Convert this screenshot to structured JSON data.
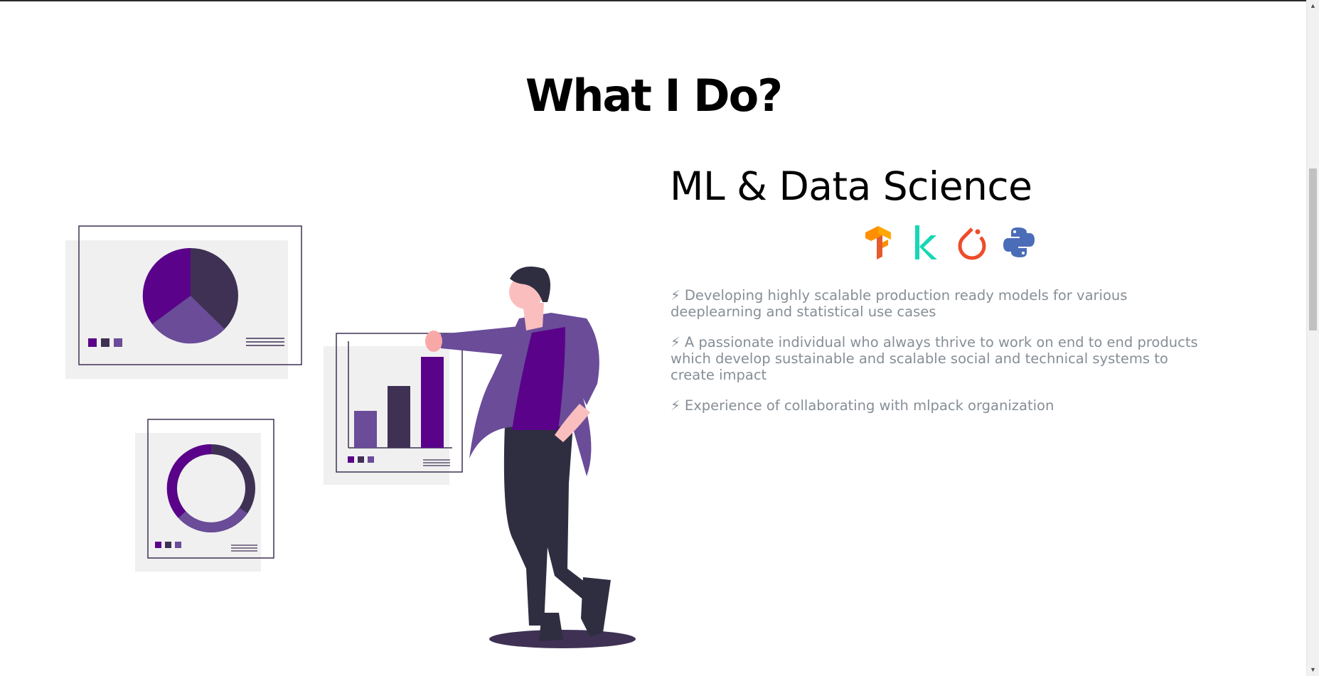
{
  "page": {
    "title": "What I Do?"
  },
  "section": {
    "title": "ML & Data Science",
    "skills": [
      {
        "icon": "tensorflow-icon",
        "color": "#ff8f00"
      },
      {
        "icon": "keras-icon",
        "color": "#16d7b5"
      },
      {
        "icon": "pytorch-icon",
        "color": "#ee4c2c"
      },
      {
        "icon": "python-icon",
        "color": "#3776ab"
      }
    ],
    "bullets": [
      "⚡ Developing highly scalable production ready models for various deeplearning and statistical use cases",
      "⚡ A passionate individual who always thrive to work on end to end products which develop sustainable and scalable social and technical systems to create impact",
      "⚡ Experience of collaborating with mlpack organization"
    ]
  },
  "colors": {
    "accent_purple": "#5a038a",
    "dark_purple": "#3f3154",
    "mid_purple": "#6a4c99",
    "text_muted": "#868e96"
  }
}
